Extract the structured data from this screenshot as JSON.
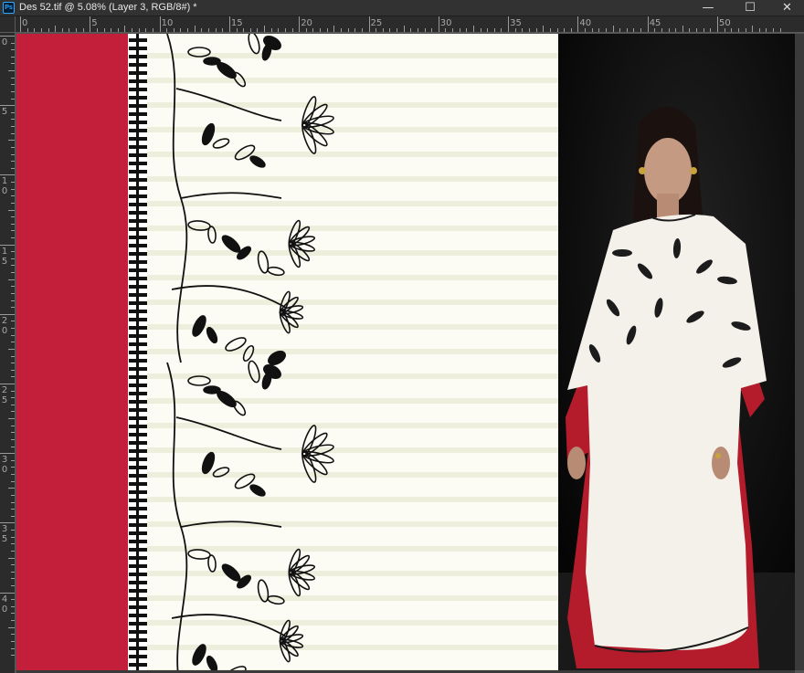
{
  "window": {
    "app_icon": "ps-app-icon",
    "app_icon_text": "Ps",
    "title": "Des 52.tif @ 5.08% (Layer 3, RGB/8#) *",
    "controls": {
      "minimize": "—",
      "maximize": "☐",
      "close": "✕"
    }
  },
  "ruler_horizontal": [
    "0",
    "5",
    "10",
    "15",
    "20",
    "25",
    "30",
    "35",
    "40",
    "45",
    "50"
  ],
  "ruler_vertical": [
    "0",
    "5",
    "10",
    "15",
    "20",
    "25",
    "30",
    "35",
    "40"
  ],
  "colors": {
    "red_panel": "#c41f3a",
    "stripe_base": "#fcfcf4",
    "stripe_line": "#eeeedd",
    "ink": "#111111",
    "photo_bg": "#0c0c0c",
    "dress": "#f3f1ea",
    "dress_trim": "#b41c2c"
  },
  "document": {
    "panels": [
      "red-panel",
      "lace-border",
      "floral-border",
      "striped-ground",
      "model-photo"
    ]
  }
}
